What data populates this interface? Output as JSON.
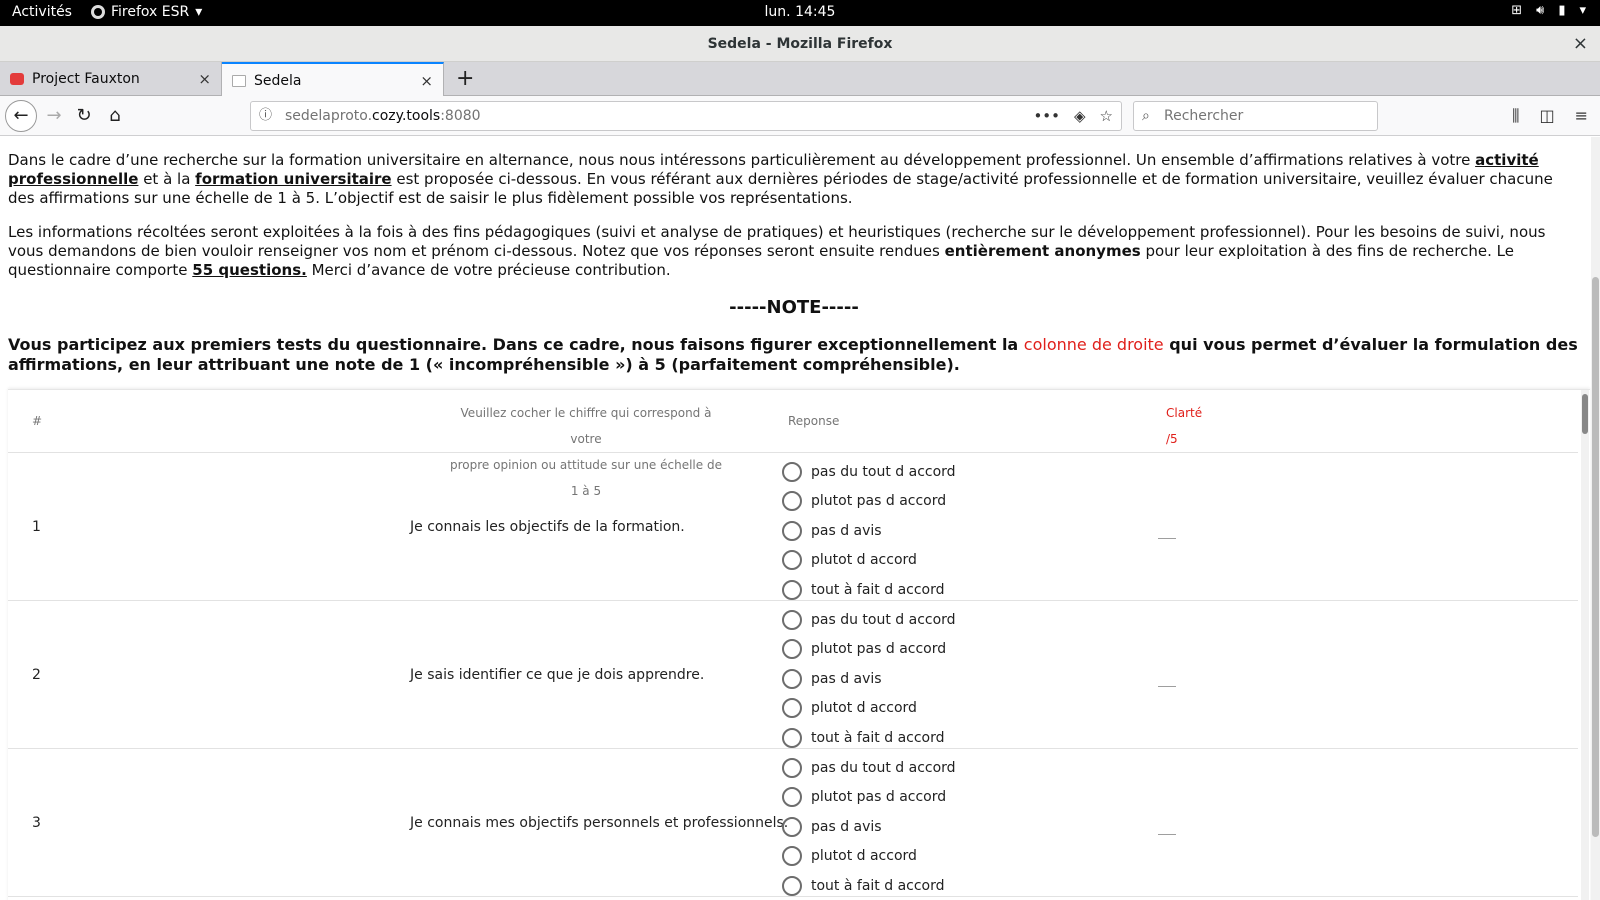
{
  "topbar": {
    "activities": "Activités",
    "app_menu": "Firefox ESR",
    "clock": "lun. 14:45",
    "icons": [
      "network-icon",
      "volume-icon",
      "battery-icon",
      "chevron-down-icon"
    ]
  },
  "window": {
    "title": "Sedela - Mozilla Firefox",
    "close": "×"
  },
  "tabs": [
    {
      "label": "Project Fauxton",
      "close": "×"
    },
    {
      "label": "Sedela",
      "close": "×"
    }
  ],
  "newtab": "+",
  "nav": {
    "url_host_prefix": "sedelaproto.",
    "url_domain": "cozy.tools",
    "url_port": ":8080",
    "search_placeholder": "Rechercher"
  },
  "intro": {
    "p1_a": "Dans le cadre d’une recherche sur la formation universitaire en alternance, nous nous intéressons particulièrement au développement professionnel. Un ensemble d’affirmations relatives à votre ",
    "p1_b": "activité professionnelle",
    "p1_c": " et à la ",
    "p1_d": "formation universitaire",
    "p1_e": " est proposée ci-dessous. En vous référant aux dernières périodes de stage/activité professionnelle et de formation universitaire, veuillez évaluer chacune des affirmations sur une échelle de 1 à 5. L’objectif est de saisir le plus fidèlement possible vos représentations.",
    "p2_a": "Les informations récoltées seront exploitées à la fois à des fins pédagogiques (suivi et analyse de pratiques) et heuristiques (recherche sur le développement professionnel). Pour les besoins de suivi, nous vous demandons de bien vouloir renseigner vos nom et prénom ci-dessous. Notez que vos réponses seront ensuite rendues ",
    "p2_b": "entièrement anonymes",
    "p2_c": " pour leur exploitation à des fins de recherche. Le questionnaire comporte ",
    "p2_d": "55 questions.",
    "p2_e": " Merci d’avance de votre précieuse contribution."
  },
  "note": {
    "title": "-----NOTE-----",
    "text_a": "Vous participez aux premiers tests du questionnaire. Dans ce cadre, nous faisons figurer exceptionnellement la ",
    "text_red": "colonne de droite",
    "text_b": " qui vous permet d’évaluer la formulation des affirmations, en leur attribuant une note de 1 (« incompréhensible ») à 5 (parfaitement compréhensible).",
    "red_color": "#e0201b"
  },
  "table": {
    "headers": {
      "num": "#",
      "question_line1": "Veuillez cocher le chiffre qui correspond à votre",
      "question_line2": "propre opinion ou attitude sur une échelle de 1 à 5",
      "response": "Reponse",
      "clarity_line1": "Clarté",
      "clarity_line2": "/5"
    },
    "rows": [
      {
        "num": "1",
        "question": "Je connais les objectifs de la formation."
      },
      {
        "num": "2",
        "question": "Je sais identifier ce que je dois apprendre."
      },
      {
        "num": "3",
        "question": "Je connais mes objectifs personnels et professionnels."
      }
    ],
    "options": [
      "pas du tout d accord",
      "plutot pas d accord",
      "pas d avis",
      "plutot d accord",
      "tout à fait d accord"
    ]
  }
}
